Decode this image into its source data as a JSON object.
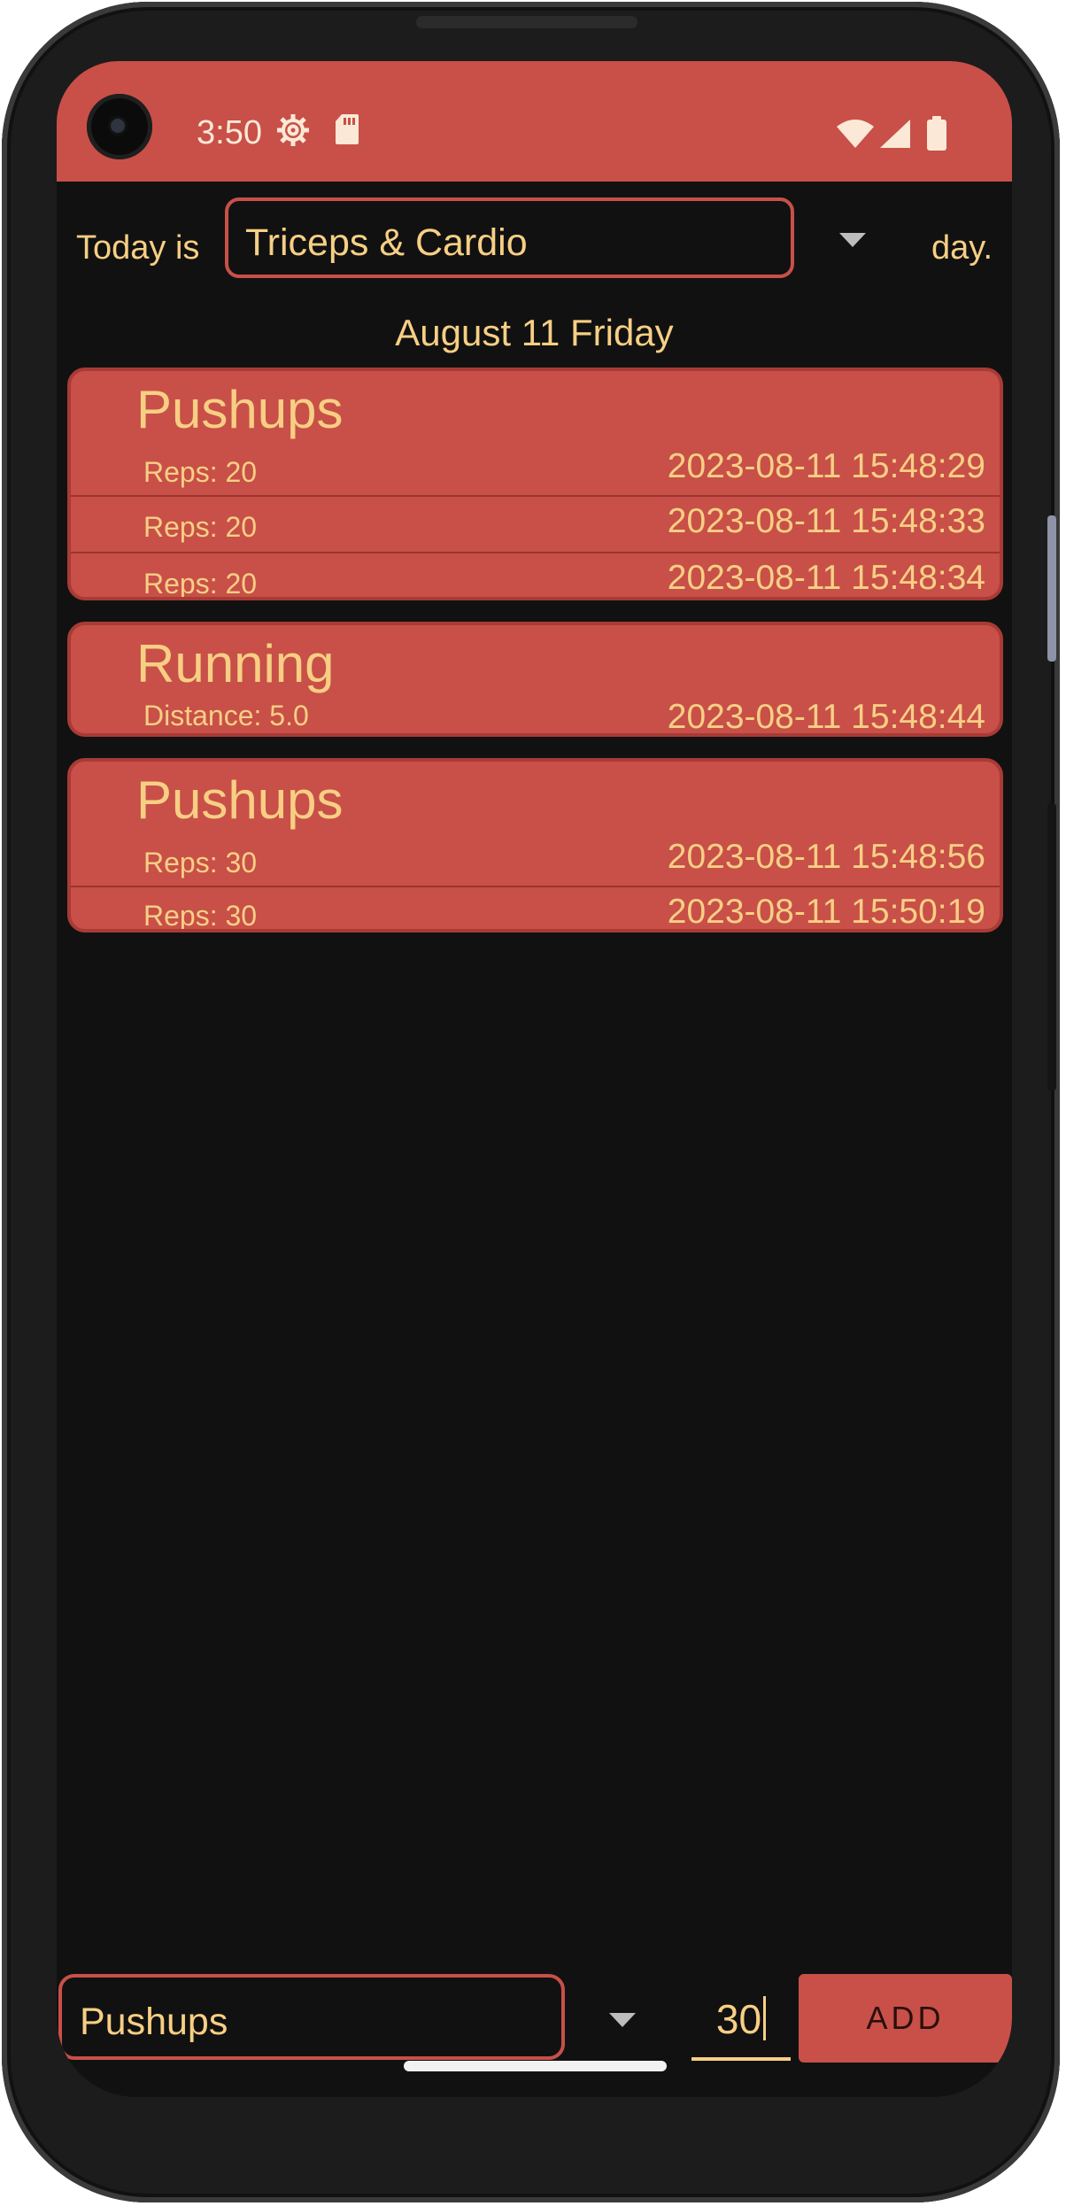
{
  "status_bar": {
    "time": "3:50",
    "icons": [
      "gear-icon",
      "sd-card-icon",
      "wifi-icon",
      "signal-icon",
      "battery-icon"
    ]
  },
  "header": {
    "prefix": "Today is",
    "day_type": "Triceps & Cardio",
    "suffix": "day."
  },
  "date_heading": "August 11 Friday",
  "groups": [
    {
      "title": "Pushups",
      "entries": [
        {
          "detail": "Reps: 20",
          "timestamp": "2023-08-11 15:48:29"
        },
        {
          "detail": "Reps: 20",
          "timestamp": "2023-08-11 15:48:33"
        },
        {
          "detail": "Reps: 20",
          "timestamp": "2023-08-11 15:48:34"
        }
      ]
    },
    {
      "title": "Running",
      "entries": [
        {
          "detail": "Distance: 5.0",
          "timestamp": "2023-08-11 15:48:44"
        }
      ]
    },
    {
      "title": "Pushups",
      "entries": [
        {
          "detail": "Reps: 30",
          "timestamp": "2023-08-11 15:48:56"
        },
        {
          "detail": "Reps: 30",
          "timestamp": "2023-08-11 15:50:19"
        }
      ]
    }
  ],
  "input_bar": {
    "exercise": "Pushups",
    "amount": "30",
    "add_label": "ADD"
  },
  "colors": {
    "accent": "#c85048",
    "text": "#f7cf84",
    "background": "#111111"
  }
}
